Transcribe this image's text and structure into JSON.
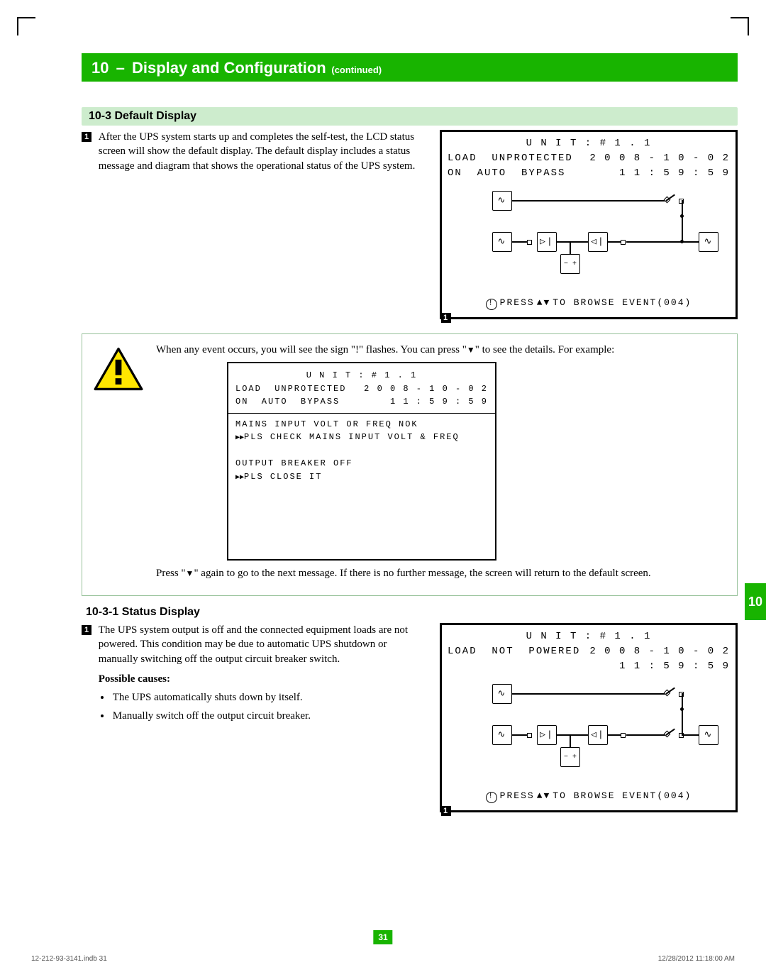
{
  "chapter": {
    "number": "10",
    "dash": " – ",
    "title": "Display and Configuration",
    "cont": " (continued)"
  },
  "sec1": {
    "heading": "10-3 Default Display",
    "marker": "1",
    "body": "After the UPS system starts up and completes the self-test, the LCD status screen will show the default display.  The default display includes a status message and diagram that shows the operational status of the UPS system."
  },
  "lcd1": {
    "unit": "U N I T : # 1 . 1",
    "l1l": "LOAD  UNPROTECTED",
    "l1r": "2 0 0 8 - 1 0 - 0 2",
    "l2l": "ON  AUTO  BYPASS",
    "l2r": "1 1 : 5 9 : 5 9",
    "foot": "PRESS    TO  BROWSE  EVENT(004)",
    "exclaim": "!",
    "marker": "1"
  },
  "note": {
    "line1_a": "When any event occurs, you will see the sign \"!\" flashes. You can press \"",
    "line1_b": "\" to see the details. For example:",
    "line2_a": "Press \"",
    "line2_b": "\" again to go to the next message. If there is no further message, the screen will return to the default screen."
  },
  "lcd2": {
    "unit": "U N I T : # 1 . 1",
    "l1l": "LOAD  UNPROTECTED",
    "l1r": "2 0 0 8 - 1 0 - 0 2",
    "l2l": "ON  AUTO  BYPASS",
    "l2r": "1 1 : 5 9 : 5 9",
    "e1": "MAINS  INPUT  VOLT  OR  FREQ  NOK",
    "e2": "PLS  CHECK  MAINS  INPUT  VOLT  &  FREQ",
    "e3": "OUTPUT  BREAKER  OFF",
    "e4": "PLS  CLOSE  IT"
  },
  "sec2": {
    "heading": "10-3-1 Status Display",
    "marker": "1",
    "body": "The UPS system output is off and the connected equipment loads are not powered. This condition may be due to automatic UPS shutdown or manually switching off the output circuit breaker switch.",
    "sub": "Possible causes:",
    "b1": "The UPS automatically shuts down by itself.",
    "b2": "Manually switch off the output circuit breaker."
  },
  "lcd3": {
    "unit": "U N I T : # 1 . 1",
    "l1l": "LOAD  NOT  POWERED",
    "l1r": "2 0 0 8 - 1 0 - 0 2",
    "l2l": " ",
    "l2r": "1 1 : 5 9 : 5 9",
    "foot": "PRESS    TO  BROWSE  EVENT(004)",
    "exclaim": "!",
    "marker": "1"
  },
  "sideTab": "10",
  "pageNum": "31",
  "footLeft": "12-212-93-3141.indb   31",
  "footRight": "12/28/2012   11:18:00 AM"
}
